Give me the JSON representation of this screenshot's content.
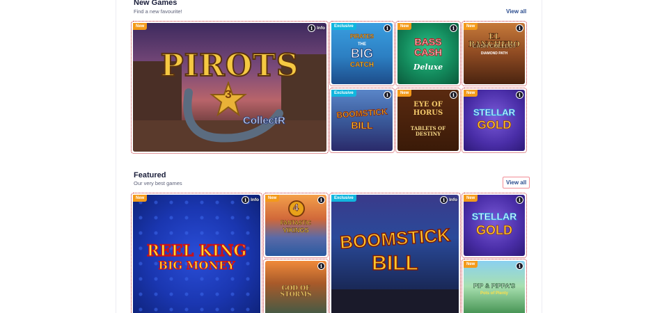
{
  "sections": {
    "new_games": {
      "title": "New Games",
      "subtitle": "Find a new favourite!",
      "view_all": "View all"
    },
    "featured": {
      "title": "Featured",
      "subtitle": "Our very best games",
      "view_all": "View all"
    }
  },
  "info_label": "Info",
  "info_glyph": "i",
  "badges": {
    "new": "New",
    "exclusive": "Exclusive"
  },
  "games": {
    "pirots": {
      "title": "PIROTS",
      "number": "3",
      "suffix": "CollectR"
    },
    "pirates_big_catch": {
      "top": "PIRATES",
      "sub": "THE",
      "title": "BIG",
      "suffix": "CATCH"
    },
    "bass_cash": {
      "title": "BASS CASH",
      "sub": "Deluxe"
    },
    "el_ranchero": {
      "title": "EL RANCHERO",
      "sub": "CASH COLLECT",
      "tag": "DIAMOND PATH"
    },
    "boomstick_small": {
      "title": "BOOMSTICK",
      "sub": "BILL"
    },
    "eye_of_horus": {
      "title": "EYE OF HORUS",
      "sub": "TABLETS OF DESTINY"
    },
    "stellar_gold_small": {
      "title": "STELLAR",
      "sub": "GOLD"
    },
    "reel_king": {
      "title": "REEL KING",
      "sub": "BIG MONEY"
    },
    "fantastic_vikings": {
      "number": "4",
      "title": "FANTASTIC",
      "sub": "VIKINGS"
    },
    "god_of_storms": {
      "title": "GOD OF STORMS"
    },
    "boomstick_large": {
      "title": "BOOMSTICK",
      "sub": "BILL"
    },
    "stellar_gold_feat": {
      "title": "STELLAR",
      "sub": "GOLD"
    },
    "pip_pippa": {
      "title": "PIP & PIPPA'S",
      "sub": "Pots of Plenty"
    }
  },
  "colors": {
    "badge_new": "#f39a1a",
    "badge_exclusive": "#11b6de",
    "link": "#2a4c8e",
    "tile_outline": "#c2262e"
  }
}
